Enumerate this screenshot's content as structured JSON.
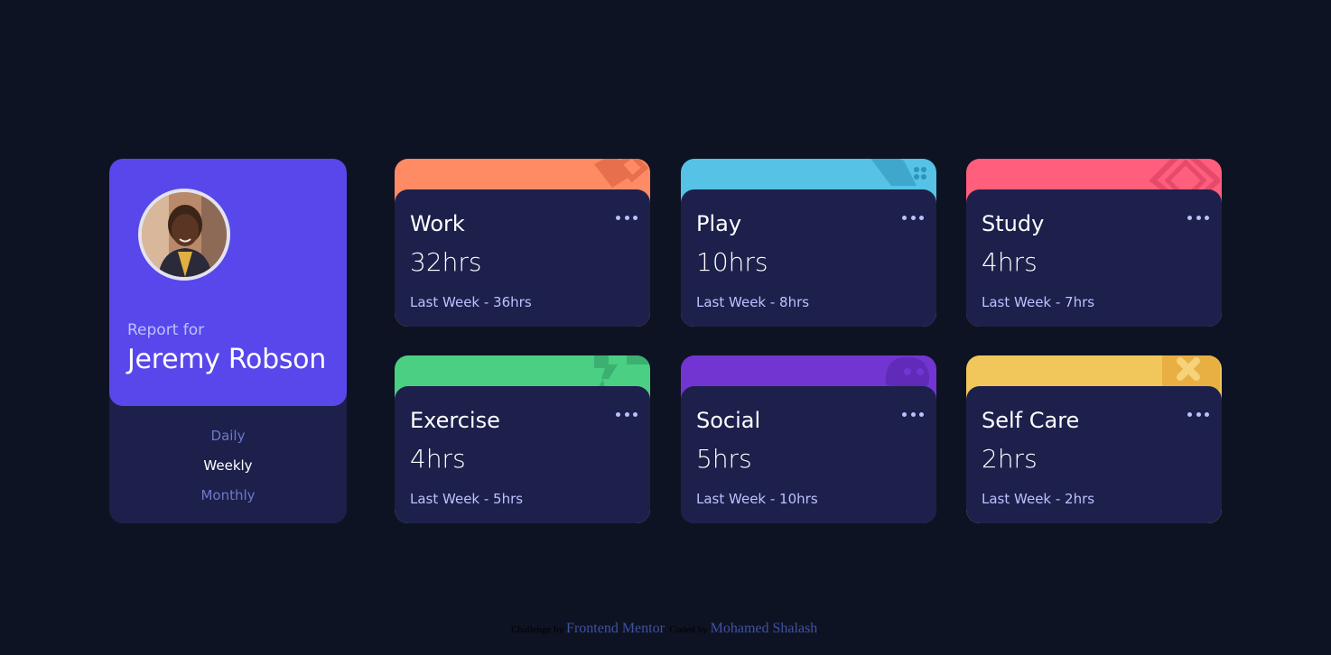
{
  "profile": {
    "report_label": "Report for",
    "name": "Jeremy Robson",
    "avatar": "avatar-photo",
    "accent_color": "#5847eb",
    "periods": [
      {
        "label": "Daily",
        "active": false
      },
      {
        "label": "Weekly",
        "active": true
      },
      {
        "label": "Monthly",
        "active": false
      }
    ]
  },
  "activities": [
    {
      "title": "Work",
      "hours": "32hrs",
      "last_week": "Last Week - 36hrs",
      "color": "#ff8b64",
      "icon": "briefcase-icon"
    },
    {
      "title": "Play",
      "hours": "10hrs",
      "last_week": "Last Week - 8hrs",
      "color": "#55c2e6",
      "icon": "gamepad-icon"
    },
    {
      "title": "Study",
      "hours": "4hrs",
      "last_week": "Last Week - 7hrs",
      "color": "#ff5e7d",
      "icon": "book-icon"
    },
    {
      "title": "Exercise",
      "hours": "4hrs",
      "last_week": "Last Week - 5hrs",
      "color": "#4bcf82",
      "icon": "runner-icon"
    },
    {
      "title": "Social",
      "hours": "5hrs",
      "last_week": "Last Week - 10hrs",
      "color": "#7335d2",
      "icon": "chat-icon"
    },
    {
      "title": "Self Care",
      "hours": "2hrs",
      "last_week": "Last Week - 2hrs",
      "color": "#f1c75b",
      "icon": "plus-icon"
    }
  ],
  "footer": {
    "challenge_text": "Challenge by",
    "challenge_link": "Frontend Mentor",
    "coded_text": "Coded by",
    "author_link": "Mohamed Shalash"
  }
}
